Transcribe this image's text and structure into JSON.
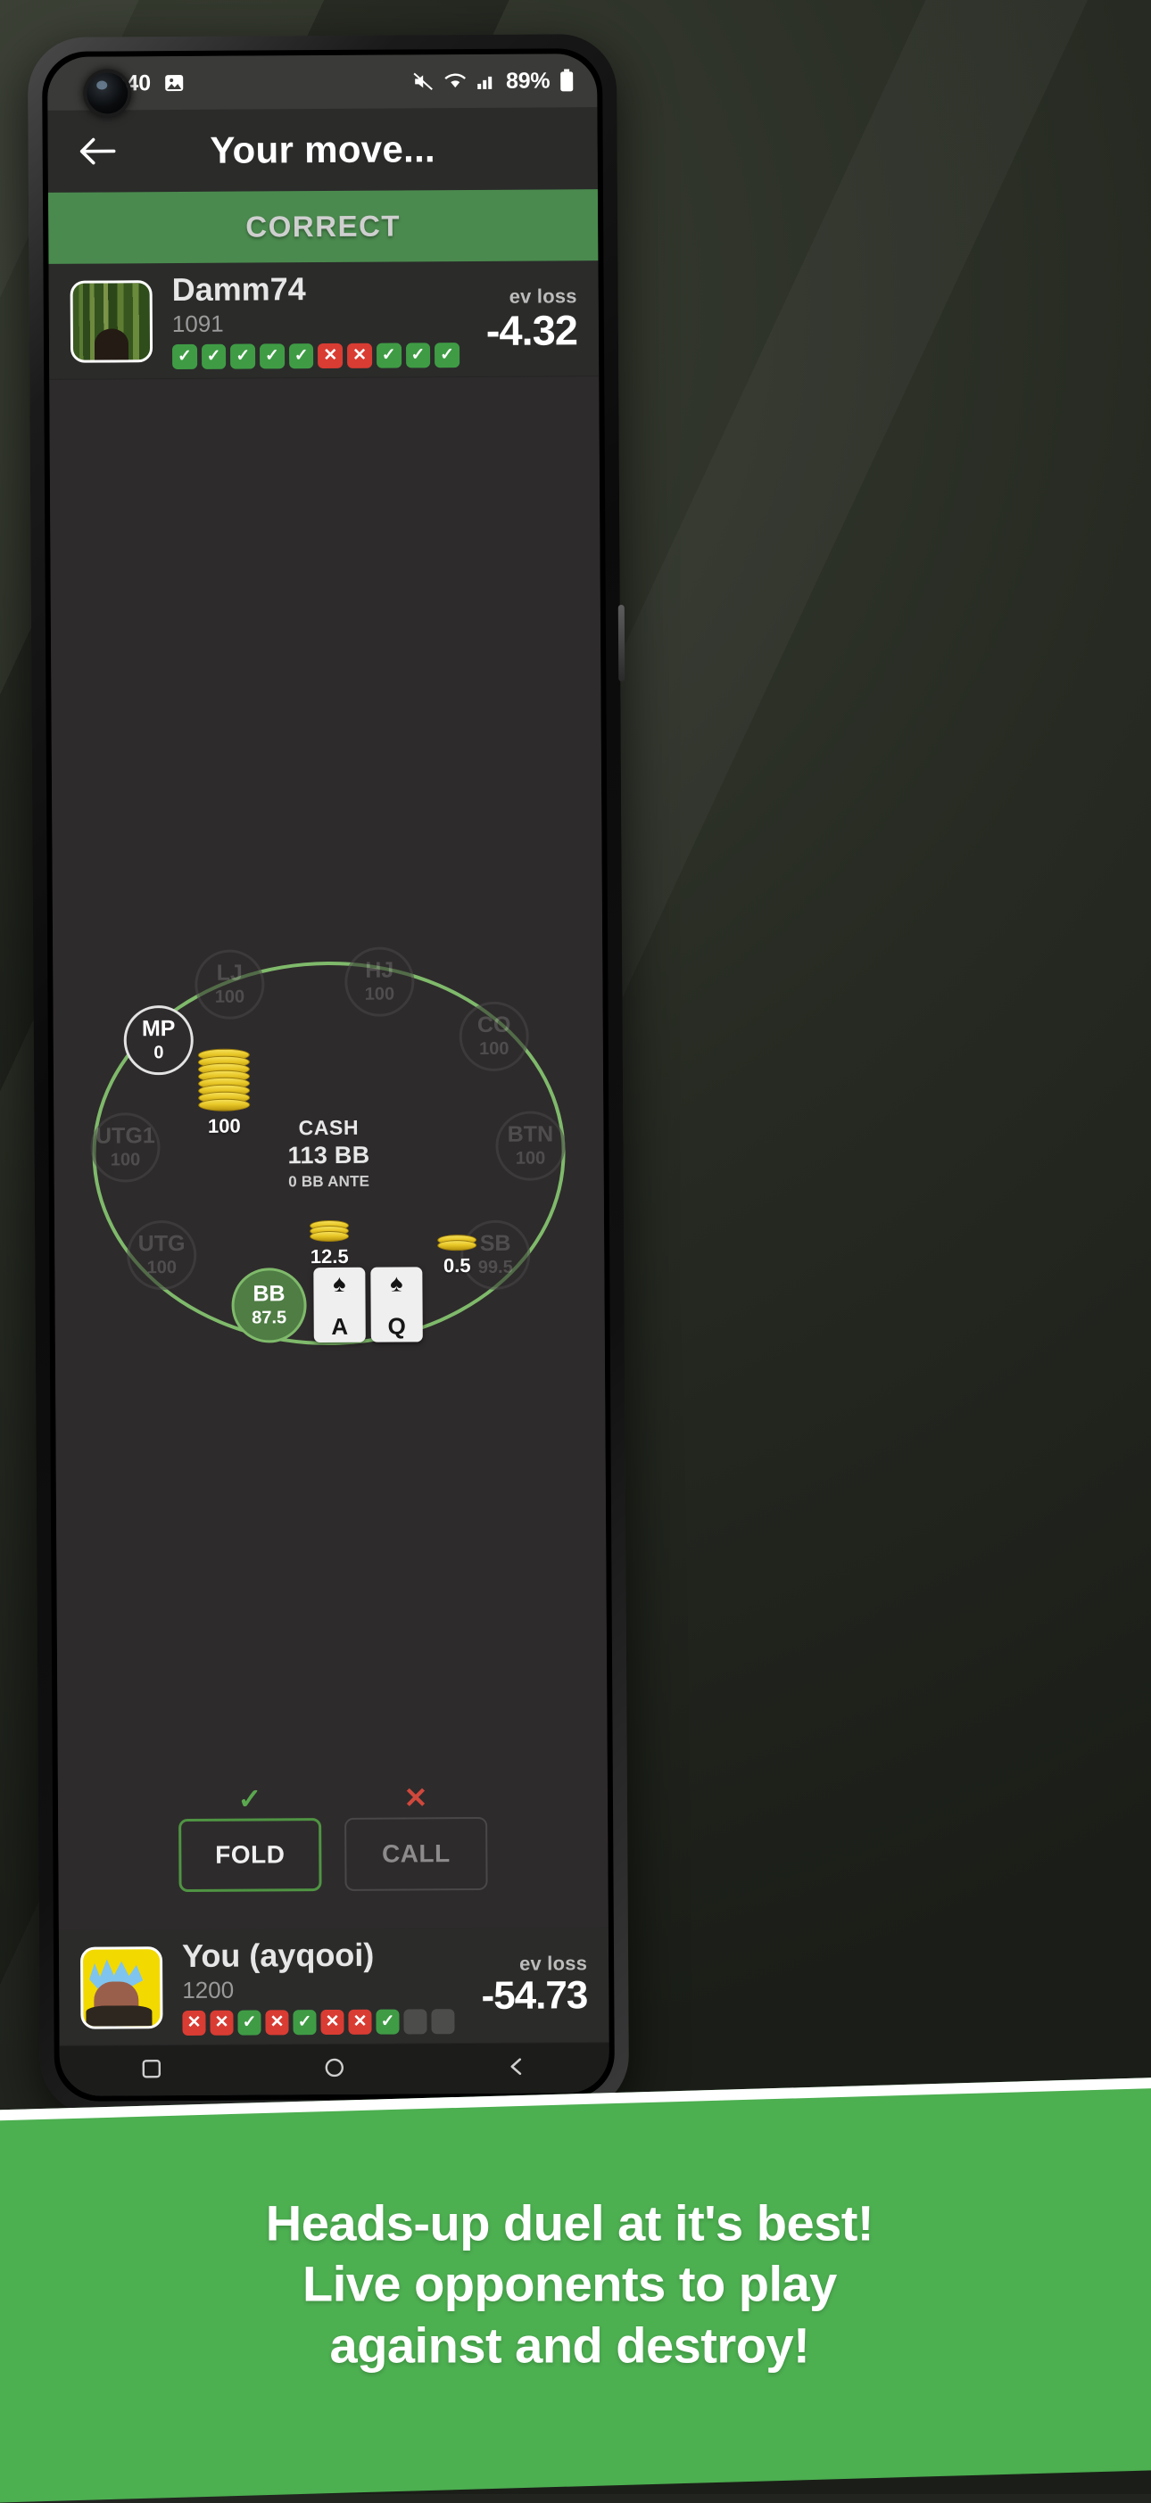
{
  "status_bar": {
    "time": "10:40",
    "left_icons": [
      "image-icon"
    ],
    "right_icons": [
      "mute-icon",
      "wifi-icon",
      "signal-icon"
    ],
    "battery_percent": "89%"
  },
  "app_header": {
    "back_icon": "back-arrow-icon",
    "title": "Your move..."
  },
  "result_banner": {
    "text": "CORRECT",
    "color": "#4a8a4e"
  },
  "opponent": {
    "name": "Damm74",
    "score": "1091",
    "avatar": "forest-photo-avatar",
    "ev_label": "ev loss",
    "ev_value": "-4.32",
    "results": [
      "win",
      "win",
      "win",
      "win",
      "win",
      "lose",
      "lose",
      "win",
      "win",
      "win"
    ]
  },
  "hero": {
    "name": "You (ayqooi)",
    "score": "1200",
    "avatar": "anime-character-avatar",
    "ev_label": "ev loss",
    "ev_value": "-54.73",
    "results": [
      "lose",
      "lose",
      "win",
      "lose",
      "win",
      "lose",
      "lose",
      "win",
      "empty",
      "empty"
    ]
  },
  "table": {
    "center": {
      "game_type": "CASH",
      "pot": "113 BB",
      "ante": "0 BB ANTE"
    },
    "seats": [
      {
        "position": "LJ",
        "stack": "100",
        "state": "dim"
      },
      {
        "position": "HJ",
        "stack": "100",
        "state": "dim"
      },
      {
        "position": "CO",
        "stack": "100",
        "state": "dim"
      },
      {
        "position": "BTN",
        "stack": "100",
        "state": "dim"
      },
      {
        "position": "SB",
        "stack": "99.5",
        "state": "dim"
      },
      {
        "position": "BB",
        "stack": "87.5",
        "state": "hero"
      },
      {
        "position": "UTG",
        "stack": "100",
        "state": "dim"
      },
      {
        "position": "UTG1",
        "stack": "100",
        "state": "dim"
      },
      {
        "position": "MP",
        "stack": "0",
        "state": "active"
      }
    ],
    "bets": [
      {
        "amount": "100",
        "size": "large"
      },
      {
        "amount": "12.5",
        "size": "medium"
      },
      {
        "amount": "0.5",
        "size": "small"
      }
    ],
    "hole_cards": [
      {
        "rank": "A",
        "suit": "♠"
      },
      {
        "rank": "Q",
        "suit": "♠"
      }
    ]
  },
  "actions": [
    {
      "label": "FOLD",
      "mark": "✓",
      "mark_type": "correct"
    },
    {
      "label": "CALL",
      "mark": "✕",
      "mark_type": "incorrect"
    }
  ],
  "nav_bar": {
    "icons": [
      "recents-icon",
      "home-icon",
      "back-icon"
    ]
  },
  "promo": {
    "line1": "Heads-up duel at it's best!",
    "line2": "Live opponents to play",
    "line3": "against and destroy!",
    "background": "#4caf50"
  }
}
